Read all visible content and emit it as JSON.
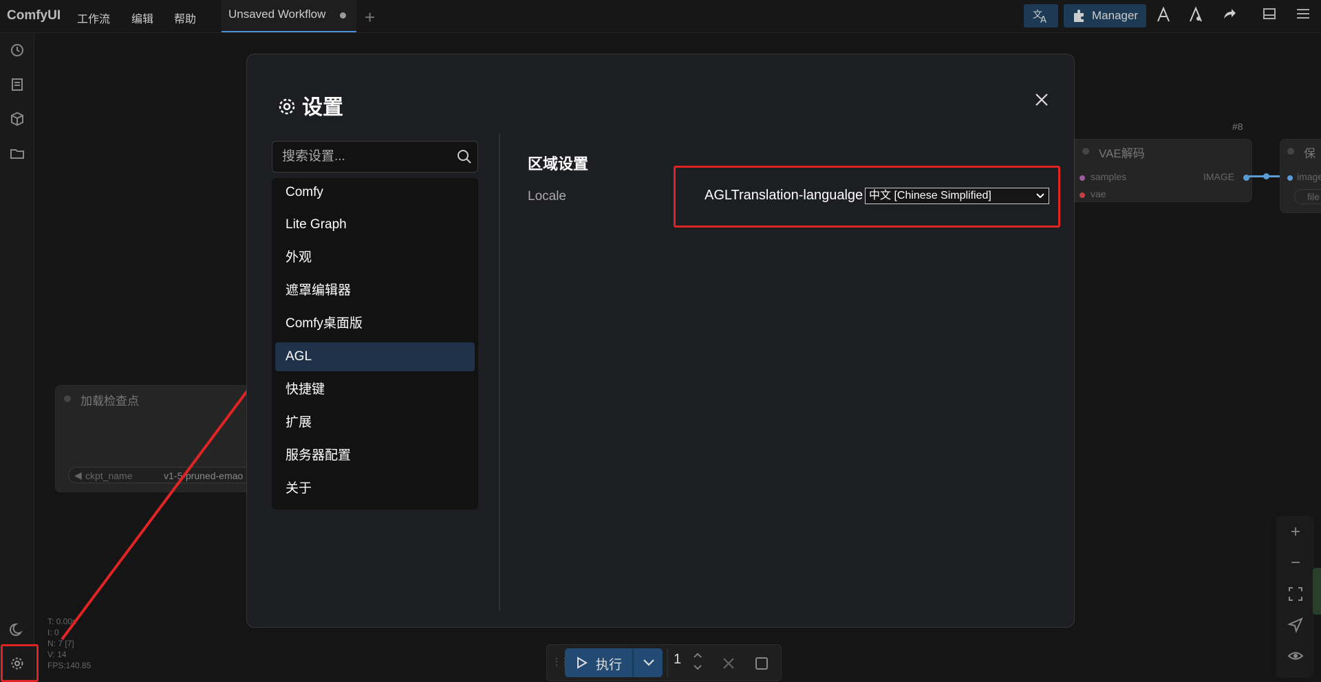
{
  "topbar": {
    "brand": "ComfyUI",
    "menus": [
      "工作流",
      "编辑",
      "帮助"
    ],
    "tab_label": "Unsaved Workflow",
    "manager_label": "Manager"
  },
  "canvas": {
    "checkpoint_node": {
      "title": "加载检查点",
      "widget_label": "ckpt_name",
      "widget_value": "v1-5-pruned-emao"
    },
    "vae_node": {
      "id": "#8",
      "title": "VAE解码",
      "inputs": [
        "samples",
        "vae"
      ],
      "output": "IMAGE"
    },
    "save_node": {
      "title": "保",
      "input": "image",
      "widget": "file"
    }
  },
  "stats": [
    "T: 0.00s",
    "I: 0",
    "N: 7 [7]",
    "V: 14",
    "FPS:140.85"
  ],
  "settings": {
    "title": "设置",
    "search_placeholder": "搜索设置...",
    "categories": [
      "Comfy",
      "Lite Graph",
      "外观",
      "遮罩编辑器",
      "Comfy桌面版",
      "AGL",
      "快捷键",
      "扩展",
      "服务器配置",
      "关于"
    ],
    "active_category": "AGL",
    "section_title": "区域设置",
    "locale_label": "Locale",
    "setting_label": "AGLTranslation-langualge",
    "select_value": "中文 [Chinese Simplified]"
  },
  "run_bar": {
    "run_label": "执行",
    "count": "1"
  },
  "colors": {
    "accent": "#234a73",
    "highlight": "#e02424",
    "active_category_bg": "#20324a"
  }
}
